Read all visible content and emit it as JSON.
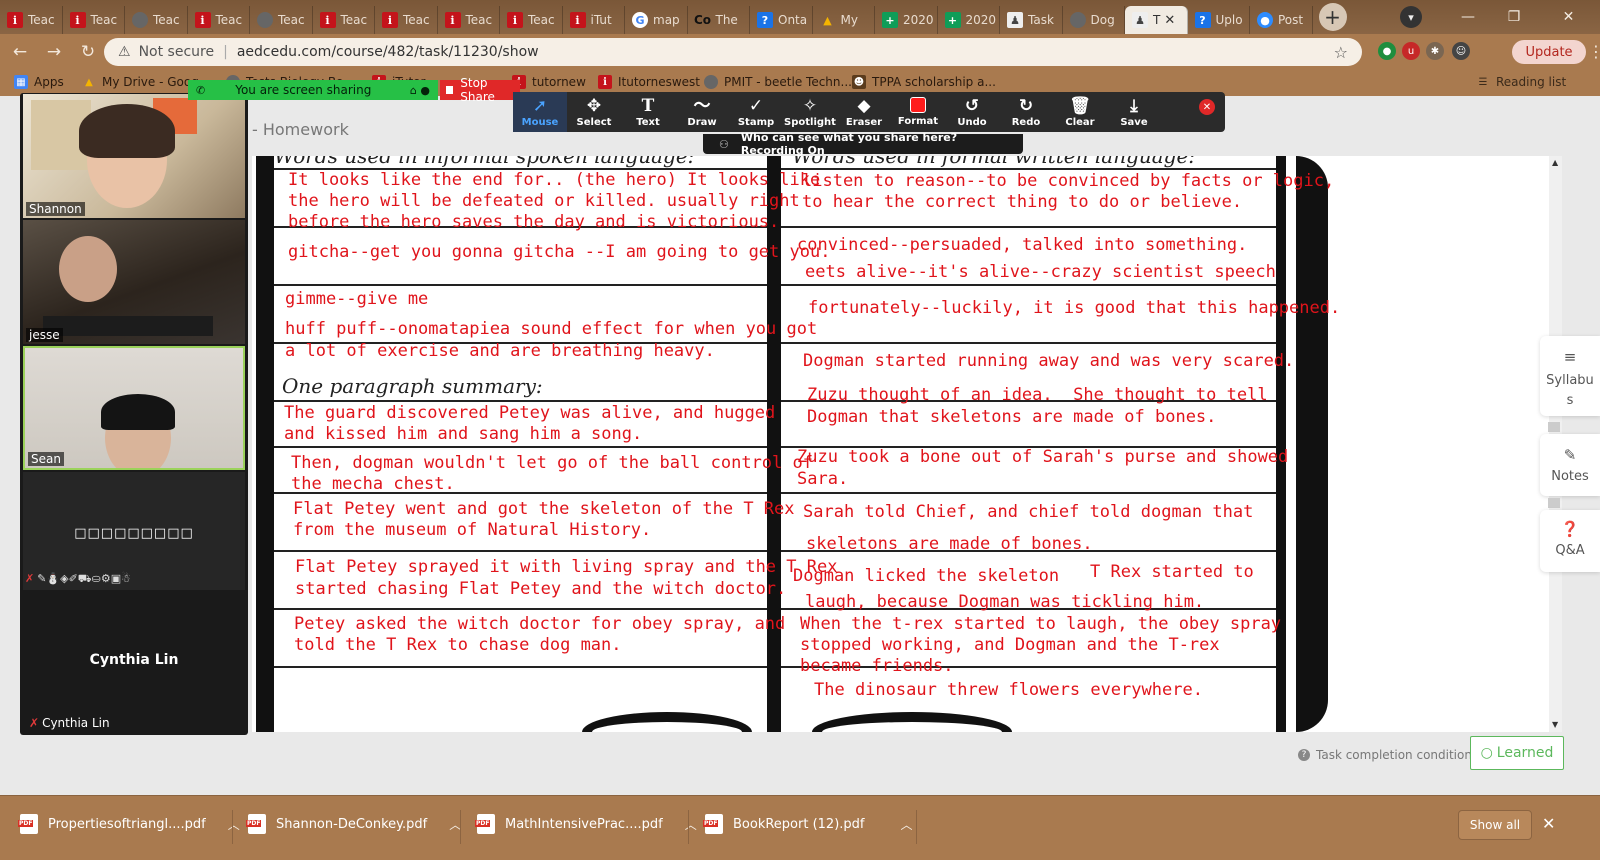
{
  "tabs": [
    {
      "label": "Teac",
      "icon": "i"
    },
    {
      "label": "Teac",
      "icon": "i"
    },
    {
      "label": "Teac",
      "icon": "globe"
    },
    {
      "label": "Teac",
      "icon": "i"
    },
    {
      "label": "Teac",
      "icon": "globe"
    },
    {
      "label": "Teac",
      "icon": "i"
    },
    {
      "label": "Teac",
      "icon": "i"
    },
    {
      "label": "Teac",
      "icon": "i"
    },
    {
      "label": "Teac",
      "icon": "i"
    },
    {
      "label": "iTut",
      "icon": "i"
    },
    {
      "label": "map",
      "icon": "g"
    },
    {
      "label": "The",
      "icon": "co"
    },
    {
      "label": "Onta",
      "icon": "blue"
    },
    {
      "label": "My",
      "icon": "drive"
    },
    {
      "label": "2020",
      "icon": "sheet"
    },
    {
      "label": "2020",
      "icon": "sheet"
    },
    {
      "label": "Task",
      "icon": "task"
    },
    {
      "label": "Dog",
      "icon": "globe"
    },
    {
      "label": "T",
      "icon": "task",
      "active": true
    },
    {
      "label": "Uplo",
      "icon": "blue"
    },
    {
      "label": "Post",
      "icon": "zoom"
    }
  ],
  "address": {
    "security": "Not secure",
    "url": "aedcedu.com/course/482/task/11230/show"
  },
  "update_label": "Update",
  "reading_list": "Reading list",
  "bookmarks": [
    {
      "label": "Apps"
    },
    {
      "label": "My Drive - Goog"
    },
    {
      "label": "Tests Biology Bo..."
    },
    {
      "label": "iTutor..."
    },
    {
      "label": "tutornew"
    },
    {
      "label": "Itutorneswest"
    },
    {
      "label": "PMIT - beetle Techn..."
    },
    {
      "label": "TPPA scholarship a..."
    }
  ],
  "page": {
    "section_title": "- Homework"
  },
  "worksheet": {
    "headings": {
      "left_top": "Words used in informal spoken language:",
      "right_top": "Words used in formal written language:",
      "summary": "One paragraph summary:"
    },
    "left_lines": [
      "It looks like the end for.. (the hero) It looks like",
      "the hero will be defeated or killed. usually right",
      "before the hero saves the day and is victorious.",
      "gitcha--get you gonna gitcha --I am going to get you.",
      "gimme--give me",
      "huff puff--onomatapiea sound effect for when you got",
      "a lot of exercise and are breathing heavy.",
      "The guard discovered Petey was alive, and hugged",
      "and kissed him and sang him a song.",
      "Then, dogman wouldn't let go of the ball control of",
      "the mecha chest.",
      "Flat Petey went and got the skeleton of the T Rex",
      "from the museum of Natural History.",
      "Flat Petey sprayed it with living spray and the T Rex",
      "started chasing Flat Petey and the witch doctor.",
      "Petey asked the witch doctor for obey spray, and",
      "told the T Rex to chase dog man."
    ],
    "right_lines": [
      "listen to reason--to be convinced by facts or logic,",
      "to hear the correct thing to do or believe.",
      "convinced--persuaded, talked into something.",
      "eets alive--it's alive--crazy scientist speech",
      "fortunately--luckily, it is good that this happened.",
      "Dogman started running away and was very scared.",
      "Zuzu thought of an idea.  She thought to tell",
      "Dogman that skeletons are made of bones.",
      "Zuzu took a bone out of Sarah's purse and showed",
      "Sara.",
      "Sarah told Chief, and chief told dogman that",
      "skeletons are made of bones.",
      "Dogman licked the skeleton",
      "T Rex started to",
      "laugh, because Dogman was tickling him.",
      "When the t-rex started to laugh, the obey spray",
      "stopped working, and Dogman and the T-rex",
      "became friends.",
      "The dinosaur threw flowers everywhere."
    ]
  },
  "side_panel": {
    "syllabus": "Syllabus",
    "notes": "Notes",
    "qa": "Q&A"
  },
  "completion": {
    "label": "Task completion condition",
    "button": "Learned"
  },
  "zoom": {
    "participants": [
      "Shannon",
      "jesse",
      "Sean"
    ],
    "blank_name": "□□□□□□□□□",
    "cynthia_name": "Cynthia Lin",
    "cynthia_label": "Cynthia Lin",
    "sharing_text": "You are screen sharing",
    "stop_share": "Stop Share",
    "who_can_see": "Who can see what you share here? Recording On",
    "tools": [
      "Mouse",
      "Select",
      "Text",
      "Draw",
      "Stamp",
      "Spotlight",
      "Eraser",
      "Format",
      "Undo",
      "Redo",
      "Clear",
      "Save"
    ],
    "selected_tool": "Mouse",
    "format_color": "#ff1c1c"
  },
  "downloads": {
    "items": [
      "Propertiesoftriangl....pdf",
      "Shannon-DeConkey.pdf",
      "MathIntensivePrac....pdf",
      "BookReport (12).pdf"
    ],
    "show_all": "Show all"
  },
  "colors": {
    "chrome_brown": "#a97a4f",
    "ink_red": "#e0141b",
    "share_green": "#26c046",
    "learned_green": "#5cb85c"
  }
}
